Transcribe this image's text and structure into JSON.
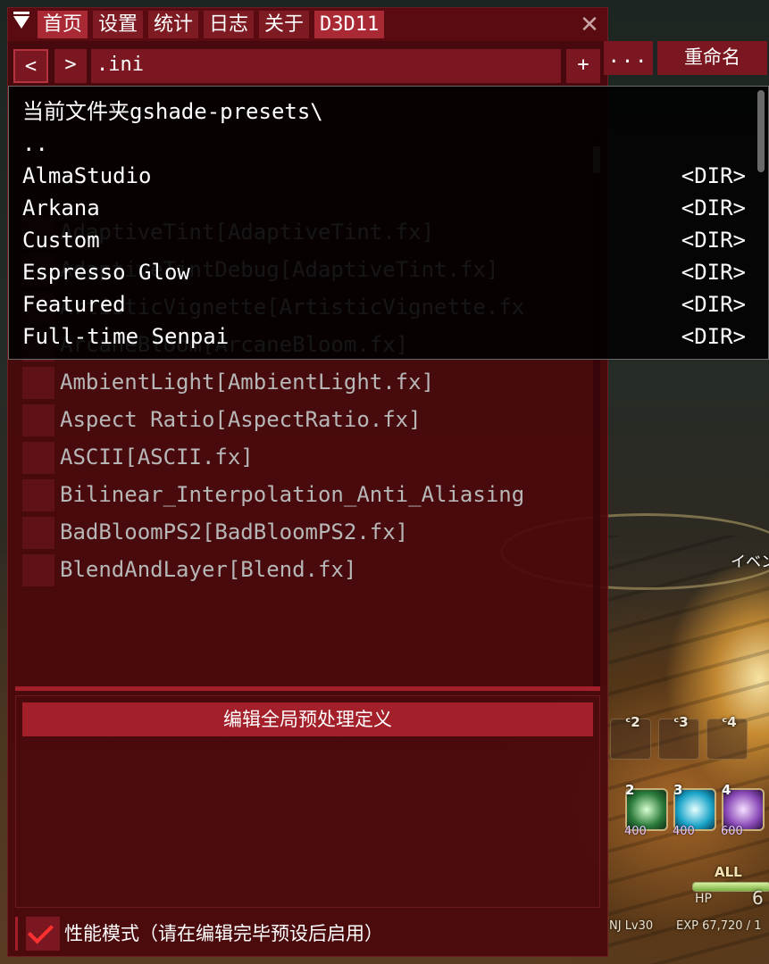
{
  "window": {
    "menu_tabs": [
      {
        "label": "首页",
        "active": true
      },
      {
        "label": "设置",
        "active": false
      },
      {
        "label": "统计",
        "active": false
      },
      {
        "label": "日志",
        "active": false
      },
      {
        "label": "关于",
        "active": false
      },
      {
        "label": "D3D11",
        "active": true
      }
    ],
    "close_glyph": "✕"
  },
  "toolbar": {
    "prev_label": "<",
    "next_label": ">",
    "path_value": ".ini",
    "add_label": "+",
    "more_label": "...",
    "rename_label": "重命名"
  },
  "file_browser": {
    "current_folder_label": "当前文件夹gshade-presets\\",
    "entries": [
      {
        "name": "..",
        "tag": ""
      },
      {
        "name": "AlmaStudio",
        "tag": "<DIR>"
      },
      {
        "name": "Arkana",
        "tag": "<DIR>"
      },
      {
        "name": "Custom",
        "tag": "<DIR>"
      },
      {
        "name": "Espresso Glow",
        "tag": "<DIR>"
      },
      {
        "name": "Featured",
        "tag": "<DIR>"
      },
      {
        "name": "Full-time Senpai",
        "tag": "<DIR>"
      }
    ]
  },
  "effects": [
    "AdaptiveTint[AdaptiveTint.fx]",
    "AdaptiveTintDebug[AdaptiveTint.fx]",
    "ArtisticVignette[ArtisticVignette.fx",
    "ArcaneBloom[ArcaneBloom.fx]",
    "AmbientLight[AmbientLight.fx]",
    "Aspect Ratio[AspectRatio.fx]",
    "ASCII[ASCII.fx]",
    "Bilinear_Interpolation_Anti_Aliasing",
    "BadBloomPS2[BadBloomPS2.fx]",
    "BlendAndLayer[Blend.fx]"
  ],
  "preprocessor_button": "编辑全局预处理定义",
  "performance_mode": {
    "label": "性能模式（请在编辑完毕预设后启用）",
    "checked": true
  },
  "game_hud": {
    "event_text": "イベン",
    "hotbar_keys": [
      "ᶜ2",
      "ᶜ3",
      "ᶜ4"
    ],
    "skills": [
      {
        "num": "2",
        "cost": "400"
      },
      {
        "num": "3",
        "cost": "400"
      },
      {
        "num": "4",
        "cost": "600"
      }
    ],
    "all_label": "ALL",
    "hp_label": "HP",
    "hp_value": "6",
    "hp_fraction": 1.0,
    "job_level": "NJ Lv30",
    "exp_text": "EXP 67,720 / 1"
  }
}
